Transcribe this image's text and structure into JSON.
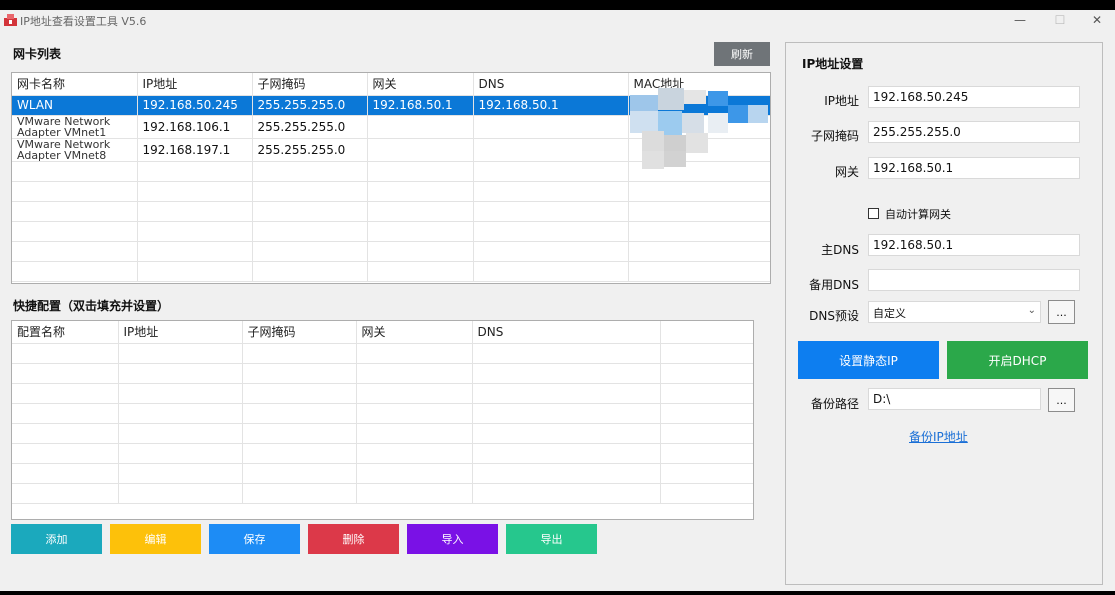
{
  "window": {
    "title": "IP地址查看设置工具 V5.6",
    "controls": {
      "minimize": "—",
      "maximize": "☐",
      "close": "✕"
    }
  },
  "adapters": {
    "section_label": "网卡列表",
    "refresh_label": "刷新",
    "columns": [
      "网卡名称",
      "IP地址",
      "子网掩码",
      "网关",
      "DNS",
      "MAC地址"
    ],
    "rows": [
      {
        "name": "WLAN",
        "ip": "192.168.50.245",
        "mask": "255.255.255.0",
        "gateway": "192.168.50.1",
        "dns": "192.168.50.1",
        "mac": ""
      },
      {
        "name": "VMware Network Adapter VMnet1",
        "ip": "192.168.106.1",
        "mask": "255.255.255.0",
        "gateway": "",
        "dns": "",
        "mac": ""
      },
      {
        "name": "VMware Network Adapter VMnet8",
        "ip": "192.168.197.1",
        "mask": "255.255.255.0",
        "gateway": "",
        "dns": "",
        "mac": ""
      }
    ],
    "selected_index": 0,
    "mac_obscured": true
  },
  "quick_config": {
    "section_label": "快捷配置（双击填充并设置）",
    "columns": [
      "配置名称",
      "IP地址",
      "子网掩码",
      "网关",
      "DNS",
      ""
    ],
    "rows": []
  },
  "ip_settings": {
    "title": "IP地址设置",
    "ip_label": "IP地址",
    "ip_value": "192.168.50.245",
    "mask_label": "子网掩码",
    "mask_value": "255.255.255.0",
    "gateway_label": "网关",
    "gateway_value": "192.168.50.1",
    "auto_gateway_label": "自动计算网关",
    "auto_gateway_checked": false,
    "dns1_label": "主DNS",
    "dns1_value": "192.168.50.1",
    "dns2_label": "备用DNS",
    "dns2_value": "",
    "dns_preset_label": "DNS预设",
    "dns_preset_value": "自定义",
    "dns_preset_more": "...",
    "static_ip_label": "设置静态IP",
    "dhcp_label": "开启DHCP",
    "backup_path_label": "备份路径",
    "backup_path_value": "D:\\",
    "backup_path_more": "...",
    "backup_link": "备份IP地址"
  },
  "actions": {
    "add": "添加",
    "edit": "编辑",
    "save": "保存",
    "delete": "删除",
    "import": "导入",
    "export": "导出"
  },
  "colors": {
    "selection": "#0b78d7",
    "static_ip_button": "#0d7ef0",
    "dhcp_button": "#2ba84a",
    "add_button": "#1ba9bd",
    "edit_button": "#fdc10a",
    "save_button": "#1d8cf5",
    "delete_button": "#dc3949",
    "import_button": "#7a11e6",
    "export_button": "#26c78d",
    "refresh_button": "#6f7478"
  }
}
